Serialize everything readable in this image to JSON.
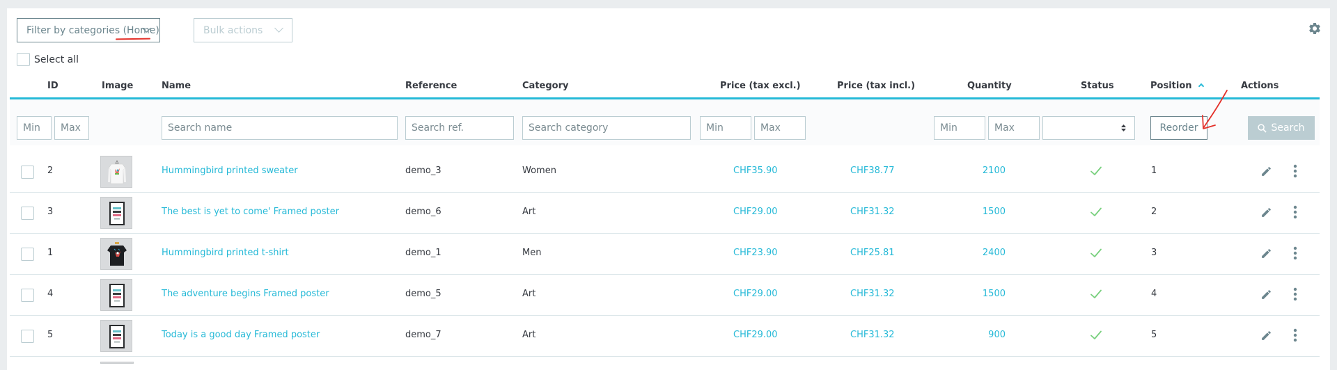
{
  "toolbar": {
    "filter_categories_label": "Filter by categories (Home)",
    "bulk_actions_label": "Bulk actions",
    "select_all_label": "Select all",
    "settings_icon": "gear-icon"
  },
  "columns": {
    "id": "ID",
    "image": "Image",
    "name": "Name",
    "reference": "Reference",
    "category": "Category",
    "price_excl": "Price (tax excl.)",
    "price_incl": "Price (tax incl.)",
    "quantity": "Quantity",
    "status": "Status",
    "position": "Position",
    "actions": "Actions"
  },
  "sort": {
    "column": "position",
    "direction": "asc"
  },
  "filters": {
    "id_min_placeholder": "Min",
    "id_max_placeholder": "Max",
    "name_placeholder": "Search name",
    "reference_placeholder": "Search ref.",
    "category_placeholder": "Search category",
    "price_min_placeholder": "Min",
    "price_max_placeholder": "Max",
    "qty_min_placeholder": "Min",
    "qty_max_placeholder": "Max",
    "status_value": "",
    "reorder_label": "Reorder",
    "search_label": "Search"
  },
  "products": [
    {
      "id": "2",
      "image": "sweater",
      "name": "Hummingbird printed sweater",
      "reference": "demo_3",
      "category": "Women",
      "price_excl": "CHF35.90",
      "price_incl": "CHF38.77",
      "quantity": "2100",
      "status": "enabled",
      "position": "1"
    },
    {
      "id": "3",
      "image": "poster",
      "name": "The best is yet to come' Framed poster",
      "reference": "demo_6",
      "category": "Art",
      "price_excl": "CHF29.00",
      "price_incl": "CHF31.32",
      "quantity": "1500",
      "status": "enabled",
      "position": "2"
    },
    {
      "id": "1",
      "image": "tshirt",
      "name": "Hummingbird printed t-shirt",
      "reference": "demo_1",
      "category": "Men",
      "price_excl": "CHF23.90",
      "price_incl": "CHF25.81",
      "quantity": "2400",
      "status": "enabled",
      "position": "3"
    },
    {
      "id": "4",
      "image": "poster",
      "name": "The adventure begins Framed poster",
      "reference": "demo_5",
      "category": "Art",
      "price_excl": "CHF29.00",
      "price_incl": "CHF31.32",
      "quantity": "1500",
      "status": "enabled",
      "position": "4"
    },
    {
      "id": "5",
      "image": "poster",
      "name": "Today is a good day Framed poster",
      "reference": "demo_7",
      "category": "Art",
      "price_excl": "CHF29.00",
      "price_incl": "CHF31.32",
      "quantity": "900",
      "status": "enabled",
      "position": "5"
    }
  ],
  "colors": {
    "accent": "#25b9d7",
    "status_enabled": "#78d07d",
    "annotation": "#e4312a"
  }
}
